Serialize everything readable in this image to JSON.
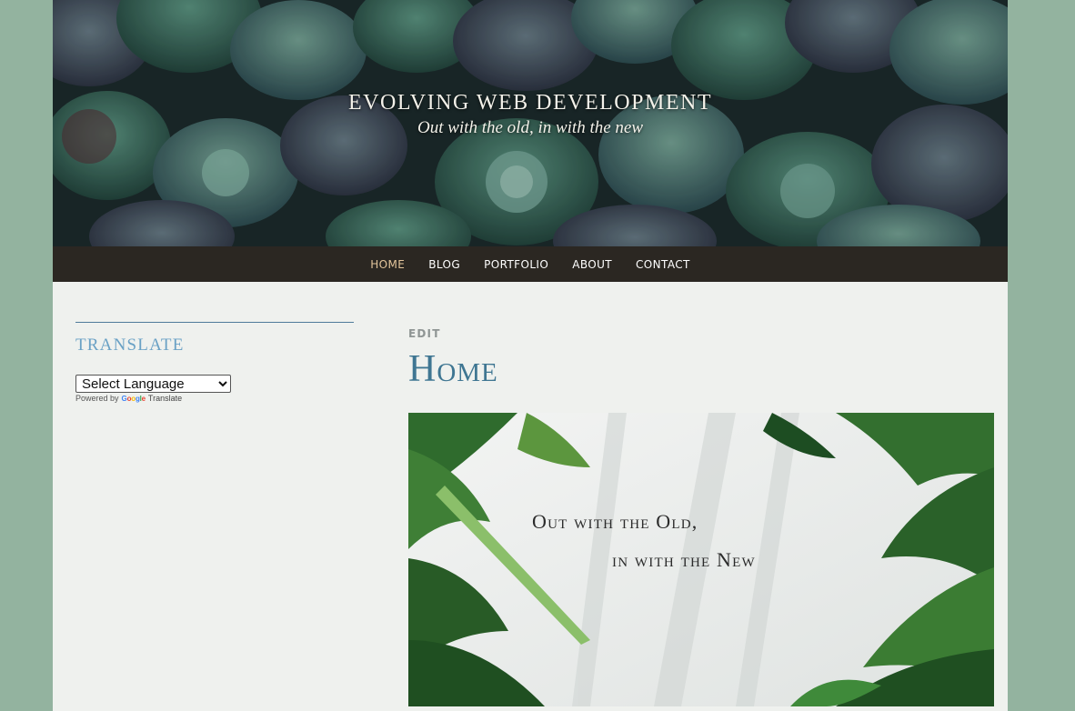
{
  "header": {
    "site_title": "EVOLVING WEB DEVELOPMENT",
    "tagline": "Out with the old, in with the new"
  },
  "nav": {
    "items": [
      {
        "label": "HOME",
        "active": true
      },
      {
        "label": "BLOG",
        "active": false
      },
      {
        "label": "PORTFOLIO",
        "active": false
      },
      {
        "label": "ABOUT",
        "active": false
      },
      {
        "label": "CONTACT",
        "active": false
      }
    ]
  },
  "sidebar": {
    "widget_title": "TRANSLATE",
    "select": {
      "selected": "Select Language"
    },
    "powered_by": "Powered by",
    "google_brand": "Google",
    "translate_link": "Translate"
  },
  "main": {
    "edit_label": "EDIT",
    "page_title": "Home",
    "hero": {
      "line1": "Out with the Old,",
      "line2": "in with the New"
    }
  },
  "colors": {
    "page_background": "#93b39f",
    "content_background": "#eff1ee",
    "nav_background": "#2b2722",
    "nav_active": "#e2c49b",
    "title_blue": "#3f7692",
    "widget_title": "#6aa1c5"
  },
  "icons": [
    "chevron-down-icon",
    "google-logo"
  ]
}
